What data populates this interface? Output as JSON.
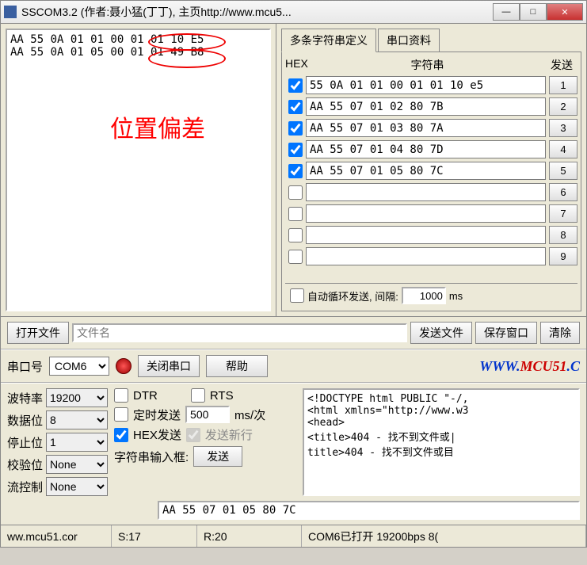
{
  "title": "SSCOM3.2 (作者:聂小猛(丁丁), 主页http://www.mcu5...",
  "recv_text": "AA 55 0A 01 01 00 01 01 10 E5\nAA 55 0A 01 05 00 01 01 49 B8",
  "red_annotation": "位置偏差",
  "tabs": {
    "multi": "多条字符串定义",
    "info": "串口资料"
  },
  "headers": {
    "hex": "HEX",
    "str": "字符串",
    "send": "发送"
  },
  "rows": [
    {
      "checked": true,
      "value": "55 0A 01 01 00 01 01 10 e5",
      "num": "1"
    },
    {
      "checked": true,
      "value": "AA 55 07 01 02 80 7B",
      "num": "2"
    },
    {
      "checked": true,
      "value": "AA 55 07 01 03 80 7A",
      "num": "3"
    },
    {
      "checked": true,
      "value": "AA 55 07 01 04 80 7D",
      "num": "4"
    },
    {
      "checked": true,
      "value": "AA 55 07 01 05 80 7C",
      "num": "5"
    },
    {
      "checked": false,
      "value": "",
      "num": "6"
    },
    {
      "checked": false,
      "value": "",
      "num": "7"
    },
    {
      "checked": false,
      "value": "",
      "num": "8"
    },
    {
      "checked": false,
      "value": "",
      "num": "9"
    }
  ],
  "loop": {
    "label": "自动循环发送, 间隔:",
    "interval": "1000",
    "ms": "ms"
  },
  "buttons": {
    "open_file": "打开文件",
    "send_file": "发送文件",
    "save_window": "保存窗口",
    "clear": "清除",
    "close_port": "关闭串口",
    "help": "帮助",
    "send": "发送"
  },
  "filename_placeholder": "文件名",
  "port_label": "串口号",
  "port_value": "COM6",
  "link_html": "WWW.MCU51.C",
  "settings": {
    "baud": {
      "label": "波特率",
      "value": "19200"
    },
    "data": {
      "label": "数据位",
      "value": "8"
    },
    "stop": {
      "label": "停止位",
      "value": "1"
    },
    "parity": {
      "label": "校验位",
      "value": "None"
    },
    "flow": {
      "label": "流控制",
      "value": "None"
    }
  },
  "mid": {
    "dtr": "DTR",
    "rts": "RTS",
    "timed_send": "定时发送",
    "timed_value": "500",
    "timed_unit": "ms/次",
    "hex_send": "HEX发送",
    "send_newline": "发送新行",
    "input_label": "字符串输入框:"
  },
  "html_preview": "<!DOCTYPE html PUBLIC \"-/,\n<html xmlns=\"http://www.w3\n<head>\n<title>404 - 找不到文件或|\ntitle>404 - 找不到文件或目",
  "send_input_value": "AA 55 07 01 05 80 7C",
  "status": {
    "url": "ww.mcu51.cor",
    "s": "S:17",
    "r": "R:20",
    "state": "COM6已打开   19200bps  8("
  }
}
